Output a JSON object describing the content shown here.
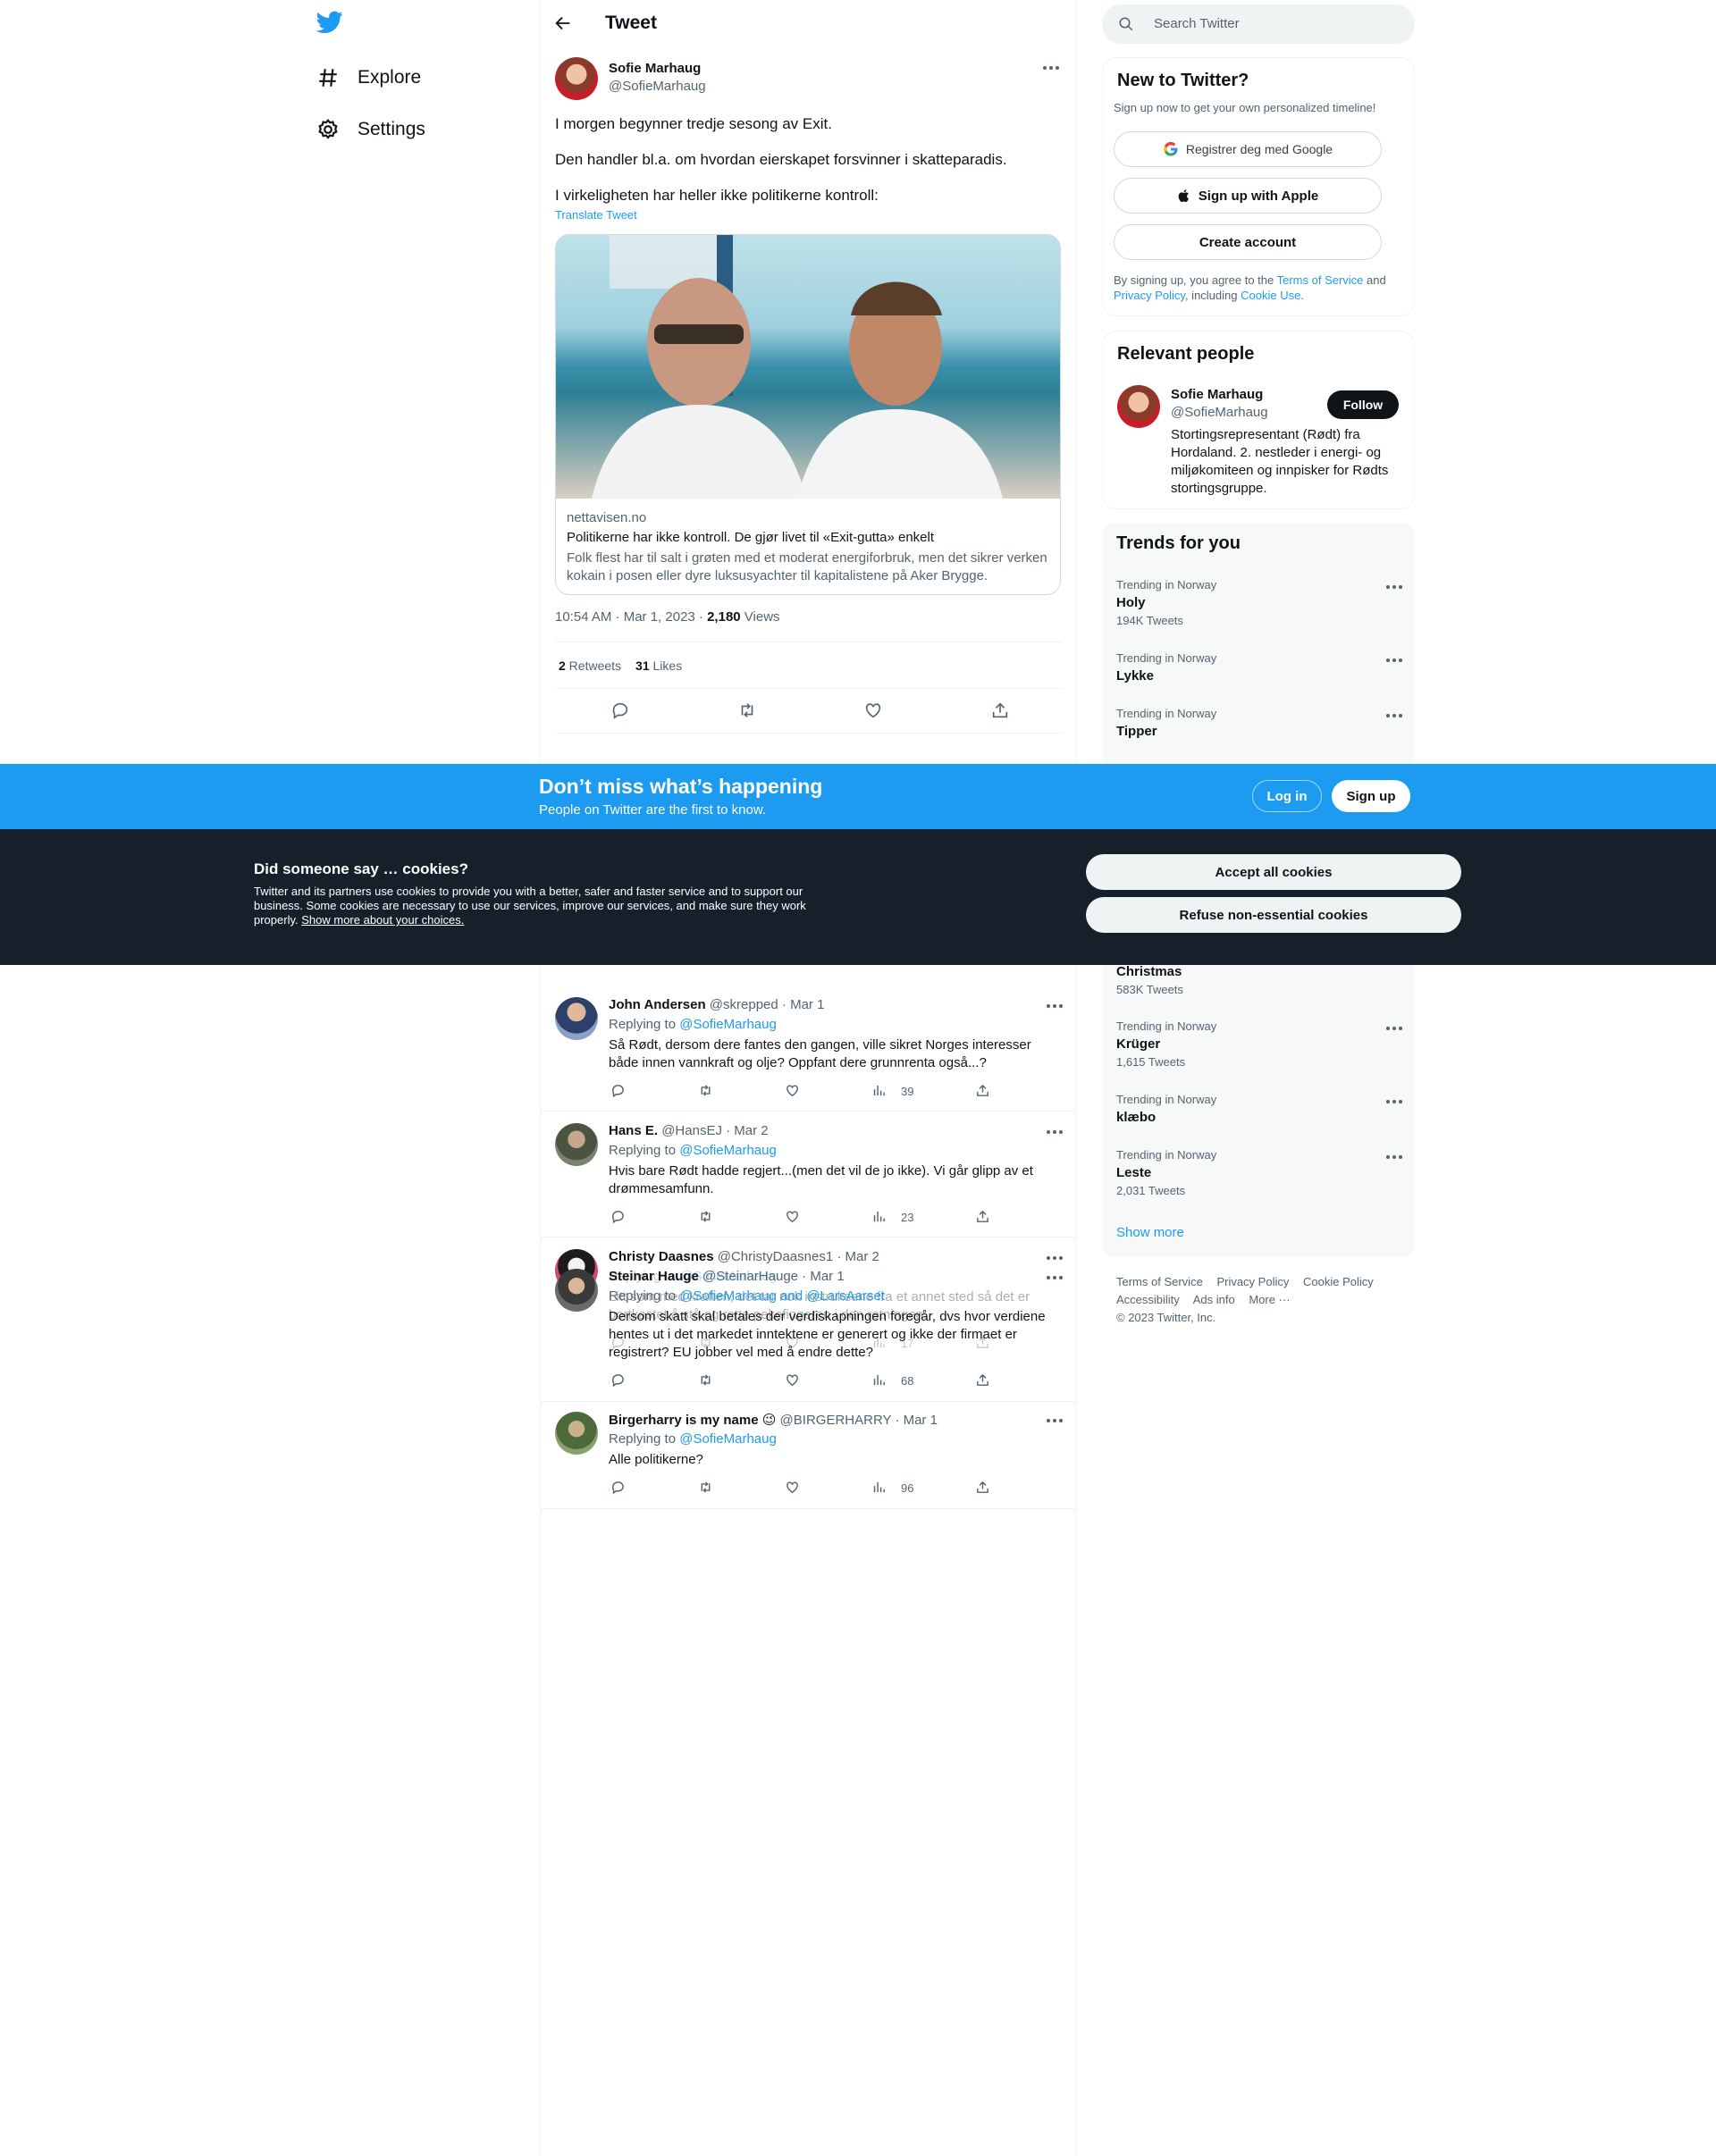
{
  "nav": {
    "explore_label": "Explore",
    "settings_label": "Settings"
  },
  "header": {
    "title": "Tweet"
  },
  "tweet": {
    "author_name": "Sofie Marhaug",
    "author_handle": "@SofieMarhaug",
    "lines": [
      "I morgen begynner tredje sesong av Exit.",
      "Den handler bl.a. om hvordan eierskapet forsvinner i skatteparadis.",
      "I virkeligheten har heller ikke politikerne kontroll:"
    ],
    "translate_label": "Translate Tweet",
    "card": {
      "site": "nettavisen.no",
      "title": "Politikerne har ikke kontroll. De gjør livet til «Exit-gutta» enkelt",
      "description": "Folk flest har til salt i grøten med et moderat energiforbruk, men det sikrer verken kokain i posen eller dyre luksusyachter til kapitalistene på Aker Brygge."
    },
    "time": "10:54 AM · Mar 1, 2023 · ",
    "views_count": "2,180",
    "views_label": " Views",
    "retweets_count": "2",
    "retweets_label": " Retweets",
    "likes_count": "31",
    "likes_label": " Likes"
  },
  "replies": [
    {
      "name": "John Andersen",
      "handle_date": " @skrepped · Mar 1",
      "replying_prefix": "Replying to ",
      "replying_to": "@SofieMarhaug",
      "text": "Så Rødt, dersom dere fantes den gangen, ville sikret Norges interesser både innen vannkraft og olje? Oppfant dere grunnrenta også...?",
      "views": "39"
    },
    {
      "name": "Hans E.",
      "handle_date": " @HansEJ · Mar 2",
      "replying_prefix": "Replying to ",
      "replying_to": "@SofieMarhaug",
      "text": "Hvis bare Rødt hadde regjert...(men det vil de jo ikke). Vi går glipp av et drømmesamfunn.",
      "views": "23"
    },
    {
      "name": "Christy Daasnes",
      "handle_date": " @ChristyDaasnes1 · Mar 2",
      "replying_prefix": "Replying to ",
      "replying_to": "@SofieMarhaug",
      "text": "Litt som med kraften, det tar nok instruksene fra et annet sted så det er bortkastet å stå og rette pekefingeren i den retningen.",
      "views": "17"
    },
    {
      "name": "Steinar Hauge",
      "handle_date": " @SteinarHauge · Mar 1",
      "replying_prefix": "Replying to ",
      "replying_to": "@SofieMarhaug and @LarsAarset",
      "text": "Dersom skatt skal betales der verdiskapningen foregår, dvs hvor verdiene hentes ut i det markedet inntektene er generert og ikke der firmaet er registrert? EU jobber vel med å endre dette?",
      "views": "68"
    },
    {
      "name": "Birgerharry is my name 😉",
      "handle_date": " @BIRGERHARRY · Mar 1",
      "replying_prefix": "Replying to ",
      "replying_to": "@SofieMarhaug",
      "text": "Alle politikerne?",
      "views": "96"
    }
  ],
  "search": {
    "placeholder": "Search Twitter"
  },
  "signup_box": {
    "title": "New to Twitter?",
    "subtitle": "Sign up now to get your own personalized timeline!",
    "google_label": "Registrer deg med Google",
    "apple_label": "Sign up with Apple",
    "create_label": "Create account",
    "legal_1": "By signing up, you agree to the ",
    "tos": "Terms of Service",
    "legal_2": " and ",
    "privacy": "Privacy Policy",
    "legal_3": ", including ",
    "cookie_use": "Cookie Use",
    "legal_4": "."
  },
  "relevant": {
    "title": "Relevant people",
    "name": "Sofie Marhaug",
    "handle": "@SofieMarhaug",
    "follow_label": "Follow",
    "bio": "Stortingsrepresentant (Rødt) fra Hordaland. 2. nestleder i energi- og miljøkomiteen og innpisker for Rødts stortingsgruppe."
  },
  "trends": {
    "title": "Trends for you",
    "items": [
      {
        "location": "Trending in Norway",
        "name": "Holy",
        "count": "194K Tweets"
      },
      {
        "location": "Trending in Norway",
        "name": "Lykke",
        "count": ""
      },
      {
        "location": "Trending in Norway",
        "name": "Tipper",
        "count": ""
      },
      {
        "location": "",
        "name": "Christmas",
        "count": "583K Tweets"
      },
      {
        "location": "Trending in Norway",
        "name": "Krüger",
        "count": "1,615 Tweets"
      },
      {
        "location": "Trending in Norway",
        "name": "klæbo",
        "count": ""
      },
      {
        "location": "Trending in Norway",
        "name": "Leste",
        "count": "2,031 Tweets"
      }
    ],
    "show_more": "Show more"
  },
  "footer": {
    "tos": "Terms of Service",
    "privacy": "Privacy Policy",
    "cookie": "Cookie Policy",
    "accessibility": "Accessibility",
    "ads": "Ads info",
    "more": "More ···",
    "copyright": "© 2023 Twitter, Inc."
  },
  "banner": {
    "title": "Don’t miss what’s happening",
    "subtitle": "People on Twitter are the first to know.",
    "login_label": "Log in",
    "signup_label": "Sign up"
  },
  "cookie_banner": {
    "title": "Did someone say … cookies?",
    "text": "Twitter and its partners use cookies to provide you with a better, safer and faster service and to support our business. Some cookies are necessary to use our services, improve our services, and make sure they work properly. ",
    "link": "Show more about your choices.",
    "accept_label": "Accept all cookies",
    "refuse_label": "Refuse non-essential cookies"
  },
  "colors": {
    "accent": "#1d9bf0",
    "text": "#0f1419",
    "muted": "#536471",
    "cookie_bg": "#15202b"
  }
}
